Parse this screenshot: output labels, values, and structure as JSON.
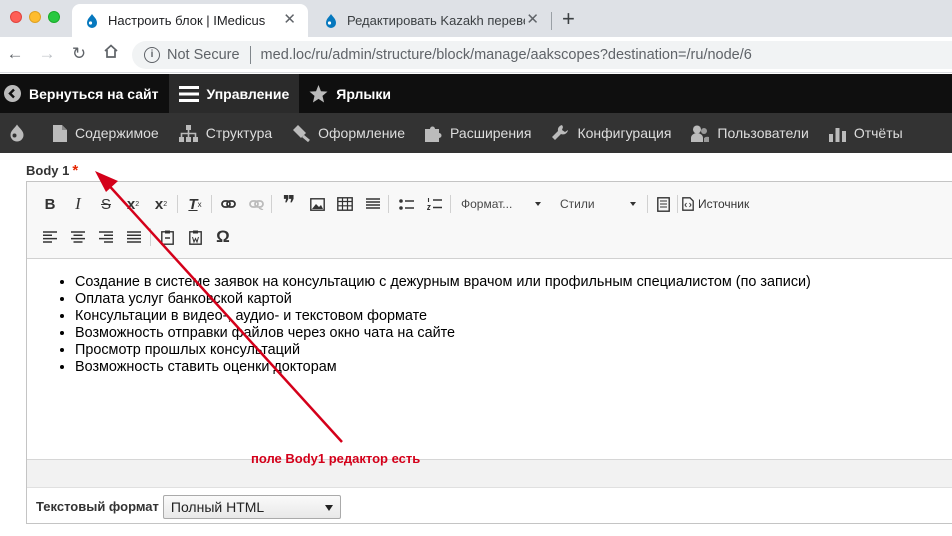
{
  "browser": {
    "tabs": [
      {
        "title": "Настроить блок | IMedicus",
        "active": true
      },
      {
        "title": "Редактировать Kazakh переве",
        "active": false
      }
    ],
    "new_tab_label": "+",
    "security_label": "Not Secure",
    "url": "med.loc/ru/admin/structure/block/manage/aakscopes?destination=/ru/node/6"
  },
  "admin_toolbar": {
    "items": [
      {
        "label": "Вернуться на сайт",
        "icon": "back-circle-icon"
      },
      {
        "label": "Управление",
        "icon": "hamburger-icon"
      },
      {
        "label": "Ярлыки",
        "icon": "star-icon"
      }
    ],
    "tray": [
      {
        "label": "",
        "icon": "drupal-drop-icon"
      },
      {
        "label": "Содержимое",
        "icon": "file-icon"
      },
      {
        "label": "Структура",
        "icon": "structure-icon"
      },
      {
        "label": "Оформление",
        "icon": "paintbrush-icon"
      },
      {
        "label": "Расширения",
        "icon": "puzzle-icon"
      },
      {
        "label": "Конфигурация",
        "icon": "wrench-icon"
      },
      {
        "label": "Пользователи",
        "icon": "people-icon"
      },
      {
        "label": "Отчёты",
        "icon": "bar-chart-icon"
      }
    ]
  },
  "field": {
    "label": "Body 1",
    "required_marker": "*"
  },
  "editor": {
    "toolbar": {
      "bold": "B",
      "italic": "I",
      "strike": "S",
      "superscript": "x",
      "subscript": "x",
      "remove_format": "T",
      "blockquote": "❞",
      "format_combo": "Формат...",
      "styles_combo": "Стили",
      "source_label": "Источник",
      "special_char": "Ω"
    },
    "content_items": [
      "Создание в системе заявок на консультацию с дежурным врачом или профильным специалистом (по записи)",
      "Оплата услуг банковской картой",
      "Консультации в видео-, аудио- и текстовом формате",
      "Возможность отправки файлов через окно чата на сайте",
      "Просмотр прошлых консультаций",
      "Возможность ставить оценки докторам"
    ]
  },
  "annotation": {
    "text": "поле Body1 редактор есть",
    "color": "#d4001a"
  },
  "text_format": {
    "label": "Текстовый формат",
    "selected": "Полный HTML"
  }
}
